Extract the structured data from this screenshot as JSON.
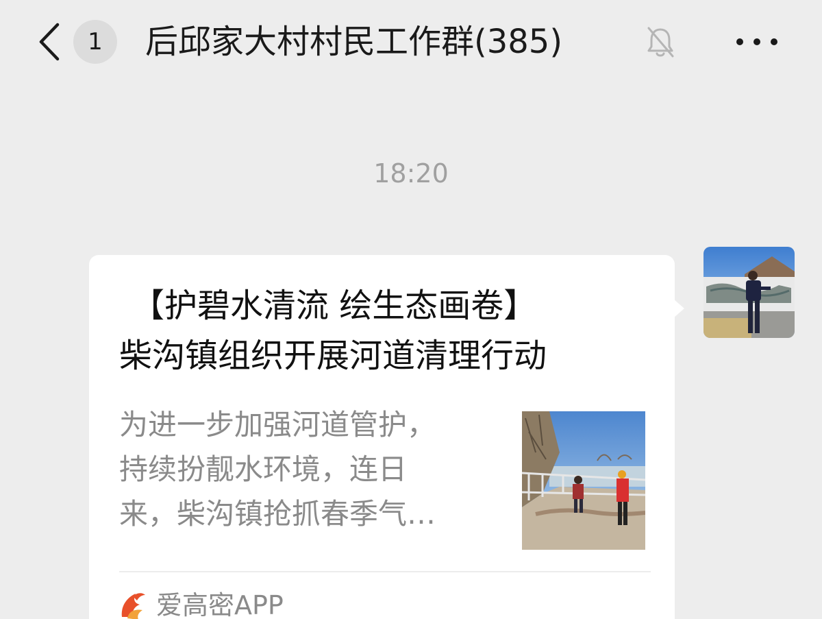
{
  "header": {
    "back_icon": "chevron-left-icon",
    "unread_count": "1",
    "title": "后邱家大村村民工作群(385)",
    "mute_icon": "bell-off-icon",
    "more_icon": "more-horizontal-icon"
  },
  "messages": [
    {
      "timestamp": "18:20",
      "type": "link-card",
      "card": {
        "title_line1": "【护碧水清流 绘生态画卷】",
        "title_line2": "柴沟镇组织开展河道清理行动",
        "desc_line1": "为进一步加强河道管护，",
        "desc_line2": "持续扮靓水环境，连日",
        "desc_line3": "来，柴沟镇抢抓春季气…",
        "source": "爱高密APP"
      }
    }
  ]
}
